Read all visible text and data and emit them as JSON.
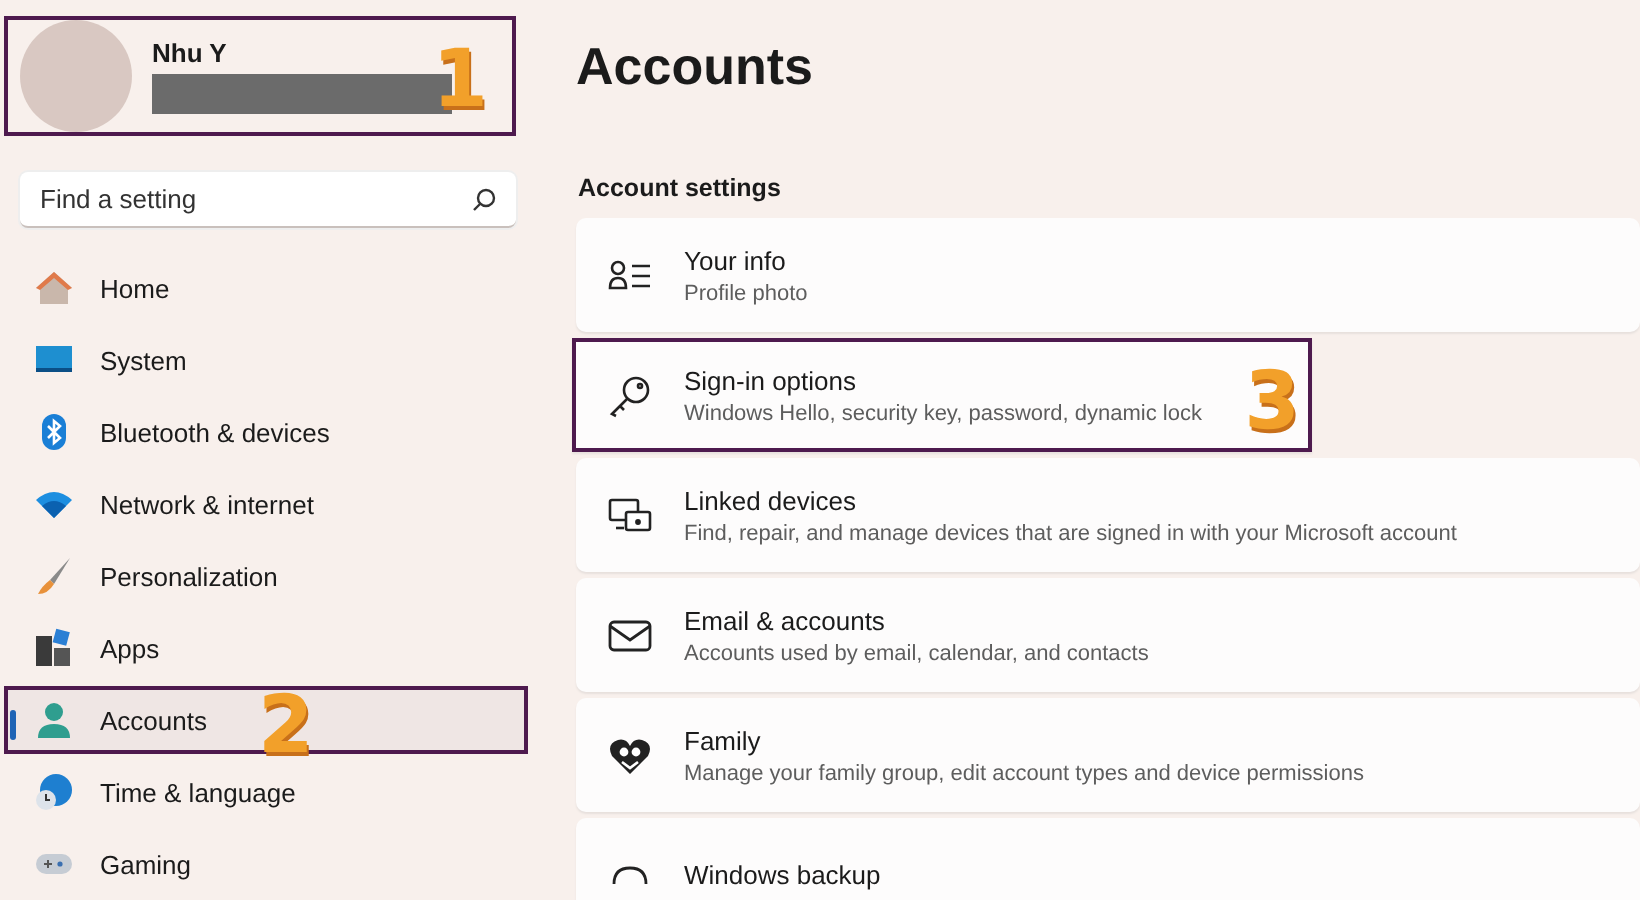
{
  "profile": {
    "name": "Nhu Y",
    "email_redacted": true,
    "callout": "1"
  },
  "search": {
    "placeholder": "Find a setting"
  },
  "nav": [
    {
      "label": "Home",
      "selected": false
    },
    {
      "label": "System",
      "selected": false
    },
    {
      "label": "Bluetooth & devices",
      "selected": false
    },
    {
      "label": "Network & internet",
      "selected": false
    },
    {
      "label": "Personalization",
      "selected": false
    },
    {
      "label": "Apps",
      "selected": false
    },
    {
      "label": "Accounts",
      "selected": true,
      "callout": "2"
    },
    {
      "label": "Time & language",
      "selected": false
    },
    {
      "label": "Gaming",
      "selected": false
    }
  ],
  "page": {
    "title": "Accounts",
    "section": "Account settings"
  },
  "cards": [
    {
      "title": "Your info",
      "subtitle": "Profile photo"
    },
    {
      "title": "Sign-in options",
      "subtitle": "Windows Hello, security key, password, dynamic lock",
      "callout": "3"
    },
    {
      "title": "Linked devices",
      "subtitle": "Find, repair, and manage devices that are signed in with your Microsoft account"
    },
    {
      "title": "Email & accounts",
      "subtitle": "Accounts used by email, calendar, and contacts"
    },
    {
      "title": "Family",
      "subtitle": "Manage your family group, edit account types and device permissions"
    },
    {
      "title": "Windows backup"
    }
  ]
}
